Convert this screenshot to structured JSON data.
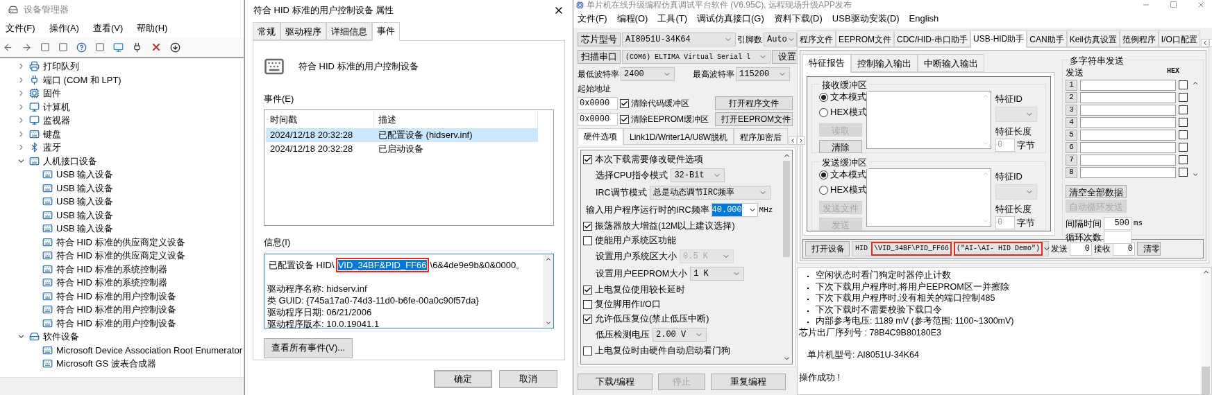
{
  "device_manager": {
    "title": "设备管理器",
    "menu": [
      "文件(F)",
      "操作(A)",
      "查看(V)",
      "帮助(H)"
    ],
    "tree": [
      {
        "label": "打印队列",
        "expanded": false
      },
      {
        "label": "端口 (COM 和 LPT)",
        "expanded": false
      },
      {
        "label": "固件",
        "expanded": false
      },
      {
        "label": "计算机",
        "expanded": false
      },
      {
        "label": "监视器",
        "expanded": false
      },
      {
        "label": "键盘",
        "expanded": false
      },
      {
        "label": "蓝牙",
        "expanded": false
      },
      {
        "label": "人机接口设备",
        "expanded": true,
        "children": [
          "USB 输入设备",
          "USB 输入设备",
          "USB 输入设备",
          "USB 输入设备",
          "USB 输入设备",
          "符合 HID 标准的供应商定义设备",
          "符合 HID 标准的供应商定义设备",
          "符合 HID 标准的系统控制器",
          "符合 HID 标准的系统控制器",
          "符合 HID 标准的用户控制设备",
          "符合 HID 标准的用户控制设备",
          "符合 HID 标准的用户控制设备"
        ]
      },
      {
        "label": "软件设备",
        "expanded": true,
        "children": [
          "Microsoft Device Association Root Enumerator",
          "Microsoft GS 波表合成器"
        ]
      }
    ]
  },
  "properties": {
    "title": "符合 HID 标准的用户控制设备 属性",
    "tabs": [
      {
        "label": "常规",
        "selected": false
      },
      {
        "label": "驱动程序",
        "selected": false
      },
      {
        "label": "详细信息",
        "selected": false
      },
      {
        "label": "事件",
        "selected": true
      }
    ],
    "device_name": "符合 HID 标准的用户控制设备",
    "events_label": "事件(E)",
    "events_table": {
      "columns": [
        "时间戳",
        "描述"
      ],
      "rows": [
        {
          "cells": [
            "2024/12/18 20:32:28",
            "已配置设备 (hidserv.inf)"
          ],
          "selected": true
        },
        {
          "cells": [
            "2024/12/18 20:32:28",
            "已启动设备"
          ],
          "selected": false
        }
      ]
    },
    "info_label": "信息(I)",
    "info_first_line": [
      {
        "text": "已配置设备 HID\\",
        "selected": false,
        "highlighted": false
      },
      {
        "text": "VID_34BF&PID_FF66",
        "selected": true,
        "highlighted": true
      },
      {
        "text": "\\6&4de9e9b&0&0000。",
        "selected": false,
        "highlighted": false
      }
    ],
    "info_lines": [
      "驱动程序名称: hidserv.inf",
      "类 GUID: {745a17a0-74d3-11d0-b6fe-00a0c90f57da}",
      "驱动程序日期: 06/21/2006",
      "驱动程序版本: 10.0.19041.1"
    ],
    "view_all_button": "查看所有事件(V)...",
    "ok_button": "确定",
    "cancel_button": "取消"
  },
  "stc": {
    "title": "单片机在线升级编程仿真调试平台软件 (V6.95C), 远程现场升级APP发布",
    "menu": [
      "文件(F)",
      "编程(O)",
      "工具(T)",
      "调试仿真接口(G)",
      "资料下载(D)",
      "USB驱动安装(D)",
      "English"
    ],
    "chip_button": "芯片型号",
    "chip": "AI8051U-34K64",
    "pins_label": "引脚数",
    "pins": "Auto",
    "scan_button": "扫描串口",
    "port": "(COM6) ELTIMA Virtual Serial l",
    "settings_button": "设置",
    "min_baud_label": "最低波特率",
    "min_baud": "2400",
    "max_baud_label": "最高波特率",
    "max_baud": "115200",
    "start_address_label": "起始地址",
    "address_rows": [
      {
        "address": "0x0000",
        "label": "清除代码缓冲区",
        "checked": true,
        "button": "打开程序文件"
      },
      {
        "address": "0x0000",
        "label": "清除EEPROM缓冲区",
        "checked": true,
        "button": "打开EEPROM文件"
      }
    ],
    "left_tabs": [
      {
        "label": "硬件选项",
        "selected": true
      },
      {
        "label": "Link1D/Writer1A/U8W脱机",
        "selected": false
      },
      {
        "label": "程序加密后",
        "selected": false
      }
    ],
    "options": [
      {
        "kind": "check",
        "label": "本次下载需要修改硬件选项",
        "checked": true
      },
      {
        "kind": "select",
        "label": "选择CPU指令模式",
        "value": "32-Bit",
        "disabled": false
      },
      {
        "kind": "select",
        "label": "IRC调节模式",
        "value": "总是动态调节IRC频率",
        "disabled": false
      },
      {
        "kind": "input",
        "label": "输入用户程序运行时的IRC频率",
        "value": "40.000",
        "selected": true,
        "unit": "MHz"
      },
      {
        "kind": "check",
        "label": "振荡器放大增益(12M以上建议选择)",
        "checked": true
      },
      {
        "kind": "check",
        "label": "使能用户系统区功能",
        "checked": false
      },
      {
        "kind": "select",
        "label": "设置用户系统区大小",
        "value": "0.5 K",
        "disabled": true
      },
      {
        "kind": "select",
        "label": "设置用户EEPROM大小",
        "value": "1   K",
        "disabled": false
      },
      {
        "kind": "check",
        "label": "上电复位使用较长延时",
        "checked": true
      },
      {
        "kind": "check",
        "label": "复位脚用作I/O口",
        "checked": false
      },
      {
        "kind": "check",
        "label": "允许低压复位(禁止低压中断)",
        "checked": true
      },
      {
        "kind": "select",
        "label": "低压检测电压",
        "value": "2.00 V",
        "disabled": false
      },
      {
        "kind": "check",
        "label": "上电复位时由硬件自动启动看门狗",
        "checked": false
      }
    ],
    "bottom_buttons": [
      {
        "label": "下载/编程",
        "disabled": false
      },
      {
        "label": "停止",
        "disabled": true
      },
      {
        "label": "重复编程",
        "disabled": false
      }
    ],
    "right_tabs": [
      {
        "label": "程序文件",
        "selected": false
      },
      {
        "label": "EEPROM文件",
        "selected": false
      },
      {
        "label": "CDC/HID-串口助手",
        "selected": false
      },
      {
        "label": "USB-HID助手",
        "selected": true
      },
      {
        "label": "CAN助手",
        "selected": false
      },
      {
        "label": "Keil仿真设置",
        "selected": false
      },
      {
        "label": "范例程序",
        "selected": false
      },
      {
        "label": "I/O口配置",
        "selected": false
      }
    ],
    "sub_tabs": [
      {
        "label": "特征报告",
        "selected": true
      },
      {
        "label": "控制输入输出",
        "selected": false
      },
      {
        "label": "中断输入输出",
        "selected": false
      }
    ],
    "buffers": [
      {
        "title": "接收缓冲区",
        "modes": [
          {
            "label": "文本模式",
            "selected": true
          },
          {
            "label": "HEX模式",
            "selected": false
          }
        ],
        "buttons": [
          {
            "label": "读取",
            "disabled": true
          },
          {
            "label": "清除",
            "disabled": false
          }
        ],
        "id_label": "特征ID",
        "length_label": "特征长度",
        "length": "0",
        "unit": "字节"
      },
      {
        "title": "发送缓冲区",
        "modes": [
          {
            "label": "文本模式",
            "selected": true
          },
          {
            "label": "HEX模式",
            "selected": false
          }
        ],
        "buttons": [
          {
            "label": "发送文件",
            "disabled": true
          },
          {
            "label": "发送",
            "disabled": true
          }
        ],
        "id_label": "特征ID",
        "length_label": "特征长度",
        "length": "0",
        "unit": "字节"
      }
    ],
    "multi_send": {
      "title": "多字符串发送",
      "send_label": "发送",
      "hex_label": "HEX",
      "rows": [
        {
          "number": "1",
          "hex": false
        },
        {
          "number": "2",
          "hex": false
        },
        {
          "number": "3",
          "hex": false
        },
        {
          "number": "4",
          "hex": false
        },
        {
          "number": "5",
          "hex": false
        },
        {
          "number": "6",
          "hex": false
        },
        {
          "number": "7",
          "hex": false
        },
        {
          "number": "8",
          "hex": false
        }
      ],
      "buttons": [
        {
          "label": "清空全部数据",
          "disabled": false
        },
        {
          "label": "自动循环发送",
          "disabled": true
        }
      ],
      "interval_label": "间隔时间",
      "interval": "500",
      "interval_unit": "ms",
      "loop_label": "循环次数"
    },
    "open_device_button": "打开设备",
    "device_parts": [
      {
        "text": "HID",
        "highlighted": false
      },
      {
        "text": "\\VID_34BF\\PID_FF66",
        "highlighted": true
      },
      {
        "text": "(\"AI-\\AI- HID Demo\")",
        "highlighted": true
      }
    ],
    "send_label": "发送",
    "send_count": "0",
    "receive_label": "接收",
    "receive_count": "0",
    "clear_button": "清零",
    "log": [
      {
        "kind": "bullet",
        "text": "空闲状态时看门狗定时器停止计数"
      },
      {
        "kind": "bullet",
        "text": "下次下载用户程序时,将用户EEPROM区一并擦除"
      },
      {
        "kind": "bullet",
        "text": "下次下载用户程序时,没有相关的端口控制485"
      },
      {
        "kind": "bullet",
        "text": "下次下载时不需要校验下载口令"
      },
      {
        "kind": "bullet",
        "text": "内部参考电压: 1189 mV (参考范围: 1100~1300mV)"
      },
      {
        "kind": "plain",
        "text": "芯片出厂序列号 : 78B4C9B80180E3"
      },
      {
        "kind": "gap"
      },
      {
        "kind": "indented",
        "text": "单片机型号: AI8051U-34K64"
      },
      {
        "kind": "gap"
      },
      {
        "kind": "plain",
        "text": "操作成功 !"
      }
    ]
  }
}
